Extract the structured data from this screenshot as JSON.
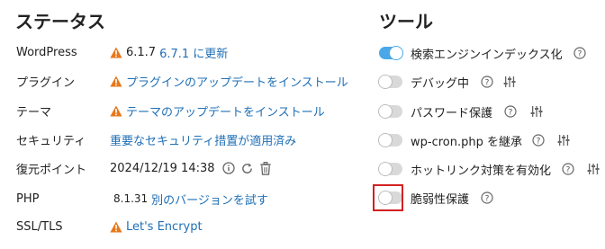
{
  "status": {
    "title": "ステータス",
    "wordpress": {
      "label": "WordPress",
      "current_version": "6.1.7",
      "update_link": "6.7.1 に更新"
    },
    "plugins": {
      "label": "プラグイン",
      "link": "プラグインのアップデートをインストール"
    },
    "theme": {
      "label": "テーマ",
      "link": "テーマのアップデートをインストール"
    },
    "security": {
      "label": "セキュリティ",
      "link": "重要なセキュリティ措置が適用済み"
    },
    "restore_point": {
      "label": "復元ポイント",
      "timestamp": "2024/12/19 14:38"
    },
    "php": {
      "label": "PHP",
      "version": "8.1.31",
      "link": "別のバージョンを試す"
    },
    "ssl": {
      "label": "SSL/TLS",
      "link": "Let's Encrypt"
    }
  },
  "tools": {
    "title": "ツール",
    "items": [
      {
        "label": "検索エンジンインデックス化",
        "enabled": true
      },
      {
        "label": "デバッグ中",
        "enabled": false
      },
      {
        "label": "パスワード保護",
        "enabled": false
      },
      {
        "label": "wp-cron.php を継承",
        "enabled": false
      },
      {
        "label": "ホットリンク対策を有効化",
        "enabled": false
      },
      {
        "label": "脆弱性保護",
        "enabled": false
      }
    ]
  },
  "colors": {
    "link": "#1f6fb5",
    "warning": "#e8771a",
    "toggle_on": "#4aa8e8",
    "toggle_off": "#d9d9d9",
    "highlight": "#d32020"
  },
  "icons": {
    "warning": "warning-triangle-icon",
    "info": "info-icon",
    "refresh": "refresh-icon",
    "trash": "trash-icon",
    "help": "help-icon",
    "settings": "sliders-icon"
  }
}
